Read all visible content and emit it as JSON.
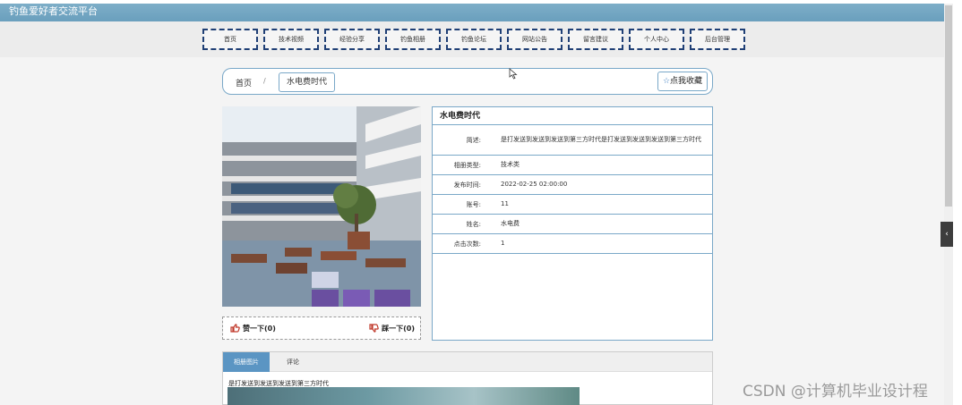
{
  "header": {
    "site_title": "钓鱼爱好者交流平台"
  },
  "nav": [
    {
      "label": "首页"
    },
    {
      "label": "技术视频"
    },
    {
      "label": "经验分享"
    },
    {
      "label": "钓鱼相册"
    },
    {
      "label": "钓鱼论坛"
    },
    {
      "label": "网站公告"
    },
    {
      "label": "留言建议"
    },
    {
      "label": "个人中心"
    },
    {
      "label": "后台管理"
    }
  ],
  "breadcrumb": {
    "home": "首页",
    "separator": "/",
    "current": "水电费时代"
  },
  "favorite_button": "点我收藏",
  "votes": {
    "like": "赞一下(0)",
    "dislike": "踩一下(0)"
  },
  "info": {
    "title": "水电费时代",
    "rows": [
      {
        "label": "简述:",
        "value": "是打发送到发送到发送到第三方时代是打发送到发送到发送到第三方时代"
      },
      {
        "label": "相册类型:",
        "value": "技术类"
      },
      {
        "label": "发布时间:",
        "value": "2022-02-25 02:00:00"
      },
      {
        "label": "账号:",
        "value": "11"
      },
      {
        "label": "姓名:",
        "value": "水电费"
      },
      {
        "label": "点击次数:",
        "value": "1"
      }
    ]
  },
  "tabs": [
    {
      "label": "相册图片"
    },
    {
      "label": "评论"
    }
  ],
  "tab_content_text": "是打发送到发送到发送到第三方时代",
  "watermark": "CSDN @计算机毕业设计程",
  "side_button": "‹",
  "colors": {
    "header": "#6a9fbd",
    "nav_border": "#1f3f75",
    "panel_border": "#7aa8c8",
    "active_tab": "#5b95c3"
  }
}
